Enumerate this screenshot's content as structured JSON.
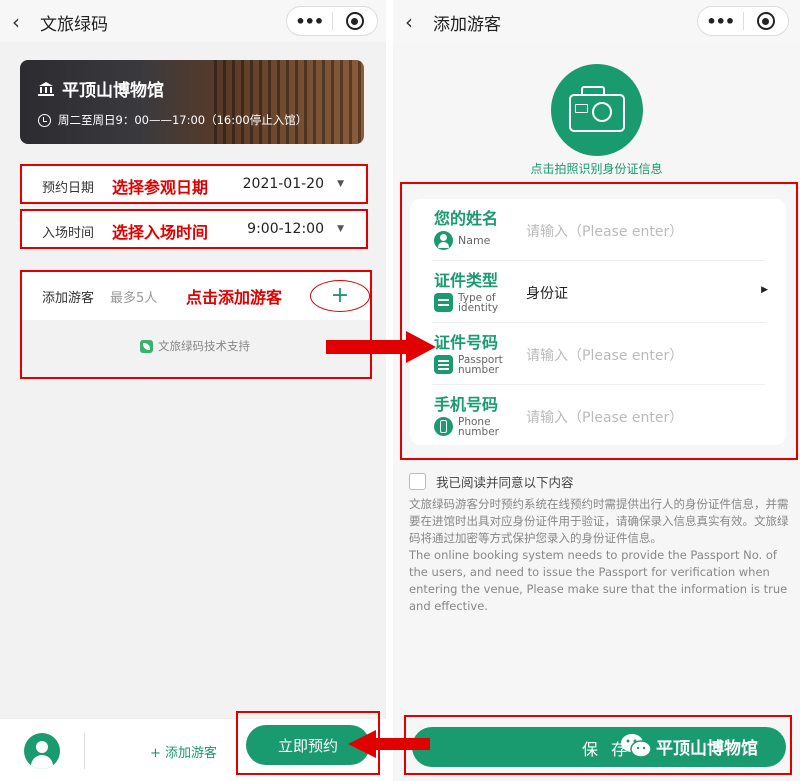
{
  "left": {
    "nav": {
      "back": "‹",
      "title": "文旅绿码"
    },
    "banner": {
      "museum_name": "平顶山博物馆",
      "hours": "周二至周日9：00——17:00（16:00停止入馆）"
    },
    "date_row": {
      "label": "预约日期",
      "annotation": "选择参观日期",
      "value": "2021-01-20"
    },
    "time_row": {
      "label": "入场时间",
      "annotation": "选择入场时间",
      "value": "9:00-12:00"
    },
    "visitors": {
      "label": "添加游客",
      "max": "最多5人",
      "annotation": "点击添加游客",
      "plus": "+",
      "support": "文旅绿码技术支持"
    },
    "bottom": {
      "add_visitor": "+ 添加游客",
      "book_now": "立即预约"
    }
  },
  "right": {
    "nav": {
      "back": "‹",
      "title": "添加游客"
    },
    "camera_tip": "点击拍照识别身份证信息",
    "form": {
      "name": {
        "cn": "您的姓名",
        "en": "Name",
        "placeholder": "请输入（Please enter）"
      },
      "id_type": {
        "cn": "证件类型",
        "en_line1": "Type of",
        "en_line2": "identity",
        "value": "身份证"
      },
      "id_number": {
        "cn": "证件号码",
        "en_line1": "Passport",
        "en_line2": "number",
        "placeholder": "请输入（Please enter）"
      },
      "phone": {
        "cn": "手机号码",
        "en_line1": "Phone",
        "en_line2": "number",
        "placeholder": "请输入（Please enter）"
      }
    },
    "agree_label": "我已阅读并同意以下内容",
    "notice_cn": "文旅绿码游客分时预约系统在线预约时需提供出行人的身份证件信息，并需要在进馆时出具对应身份证件用于验证，请确保录入信息真实有效。文旅绿码将通过加密等方式保护您录入的身份证件信息。",
    "notice_en": "The online booking system needs to provide the Passport No. of the users, and need to issue the Passport for verification when entering the venue, Please make sure that the information is true and effective.",
    "save": "保 存",
    "watermark": "平顶山博物馆"
  },
  "colors": {
    "brand_green": "#1a9a6f",
    "annotation_red": "#e00000"
  },
  "icons": [
    "back-icon",
    "more-dots-icon",
    "target-icon",
    "museum-icon",
    "clock-icon",
    "caret-down-icon",
    "plus-icon",
    "leaf-logo-icon",
    "avatar-icon",
    "camera-icon",
    "person-icon",
    "id-card-icon",
    "passport-icon",
    "phone-icon",
    "triangle-right-icon",
    "wechat-icon"
  ]
}
